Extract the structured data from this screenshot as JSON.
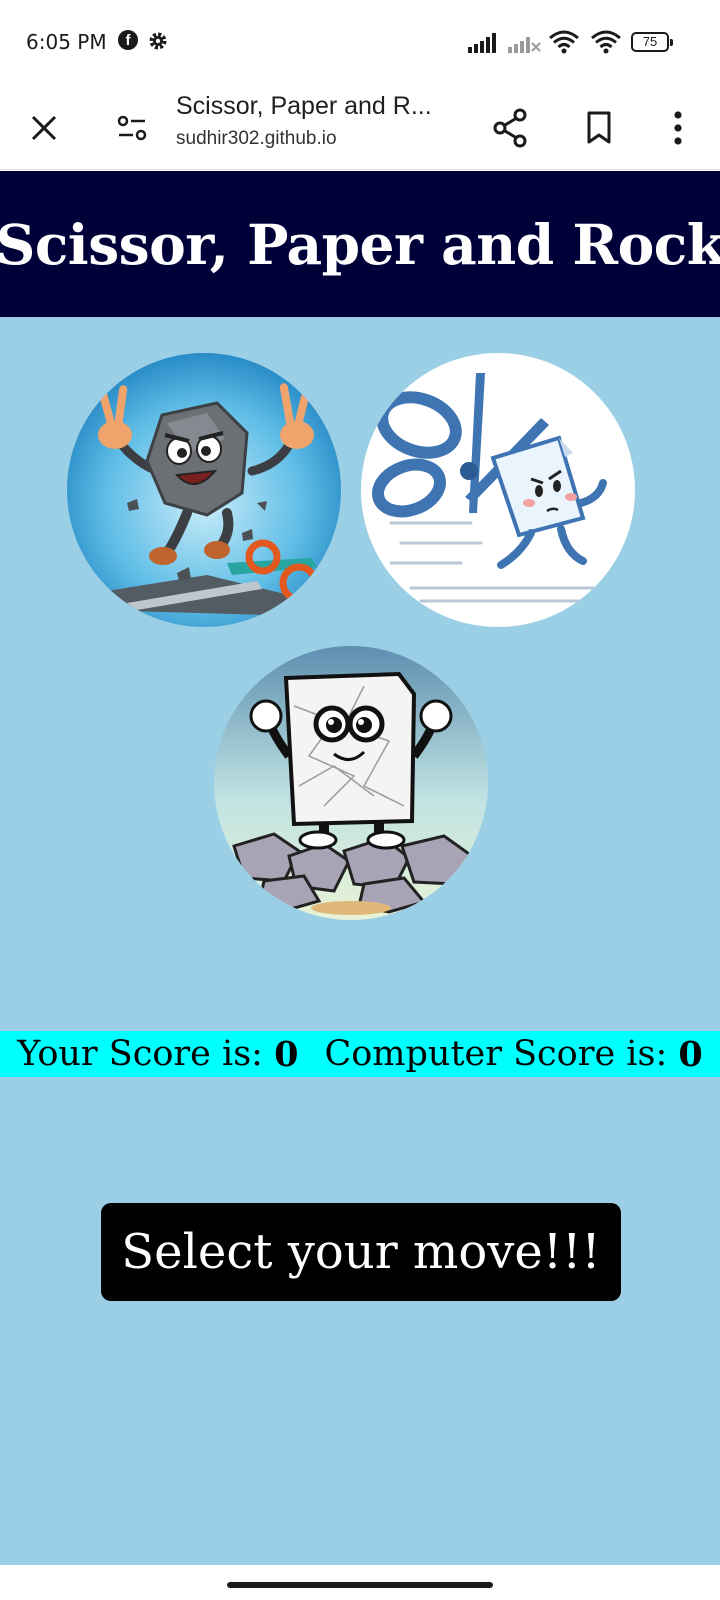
{
  "status_bar": {
    "time": "6:05 PM",
    "battery": "75",
    "icons": [
      "facebook-icon",
      "gear-icon",
      "signal-icon",
      "signal-no-service-icon",
      "wifi-icon",
      "wifi-icon",
      "battery-icon"
    ]
  },
  "browser": {
    "tab_title": "Scissor, Paper and R...",
    "url": "sudhir302.github.io",
    "icons": [
      "close-icon",
      "site-settings-icon",
      "share-icon",
      "bookmark-icon",
      "more-vert-icon"
    ]
  },
  "page": {
    "title": "Scissor, Paper and Rock",
    "choices": [
      {
        "id": "rock",
        "icon": "rock-character-image"
      },
      {
        "id": "scissor",
        "icon": "scissor-character-image"
      },
      {
        "id": "paper",
        "icon": "paper-character-image"
      }
    ],
    "score": {
      "your_label": "Your Score is:",
      "your_value": "0",
      "computer_label": "Computer Score is:",
      "computer_value": "0"
    },
    "message": "Select your move!!!"
  },
  "colors": {
    "header_bg": "#000039",
    "page_bg": "#9bcfe5",
    "score_bg": "#00ffff",
    "message_bg": "#000000"
  }
}
